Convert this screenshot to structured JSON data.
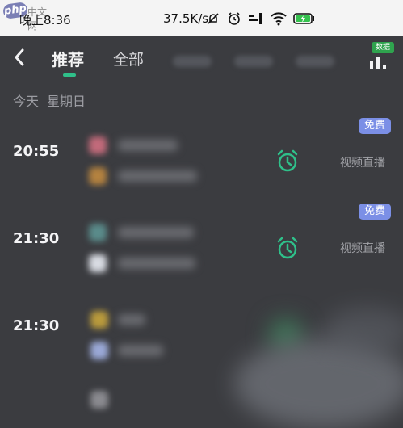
{
  "watermark": {
    "logo": "php",
    "site": "中文网"
  },
  "status_bar": {
    "time": "晚上8:36",
    "net_speed": "37.5K/s"
  },
  "nav": {
    "tabs": [
      {
        "label": "推荐",
        "active": true
      },
      {
        "label": "全部",
        "active": false
      }
    ],
    "chart_badge": "数据"
  },
  "date_header": {
    "day": "今天",
    "weekday": "星期日"
  },
  "schedule": [
    {
      "time": "20:55",
      "badge": "免费",
      "type": "视频直播"
    },
    {
      "time": "21:30",
      "badge": "免费",
      "type": "视频直播"
    },
    {
      "time": "21:30"
    }
  ],
  "colors": {
    "accent": "#2fc08a",
    "badge": "#7b8fe6",
    "background": "#3b3c40"
  },
  "icons": [
    "back-arrow-icon",
    "chart-icon",
    "alarm-clock-icon",
    "mute-icon",
    "alarm-icon",
    "hd-icon",
    "wifi-icon",
    "battery-charging-icon"
  ]
}
